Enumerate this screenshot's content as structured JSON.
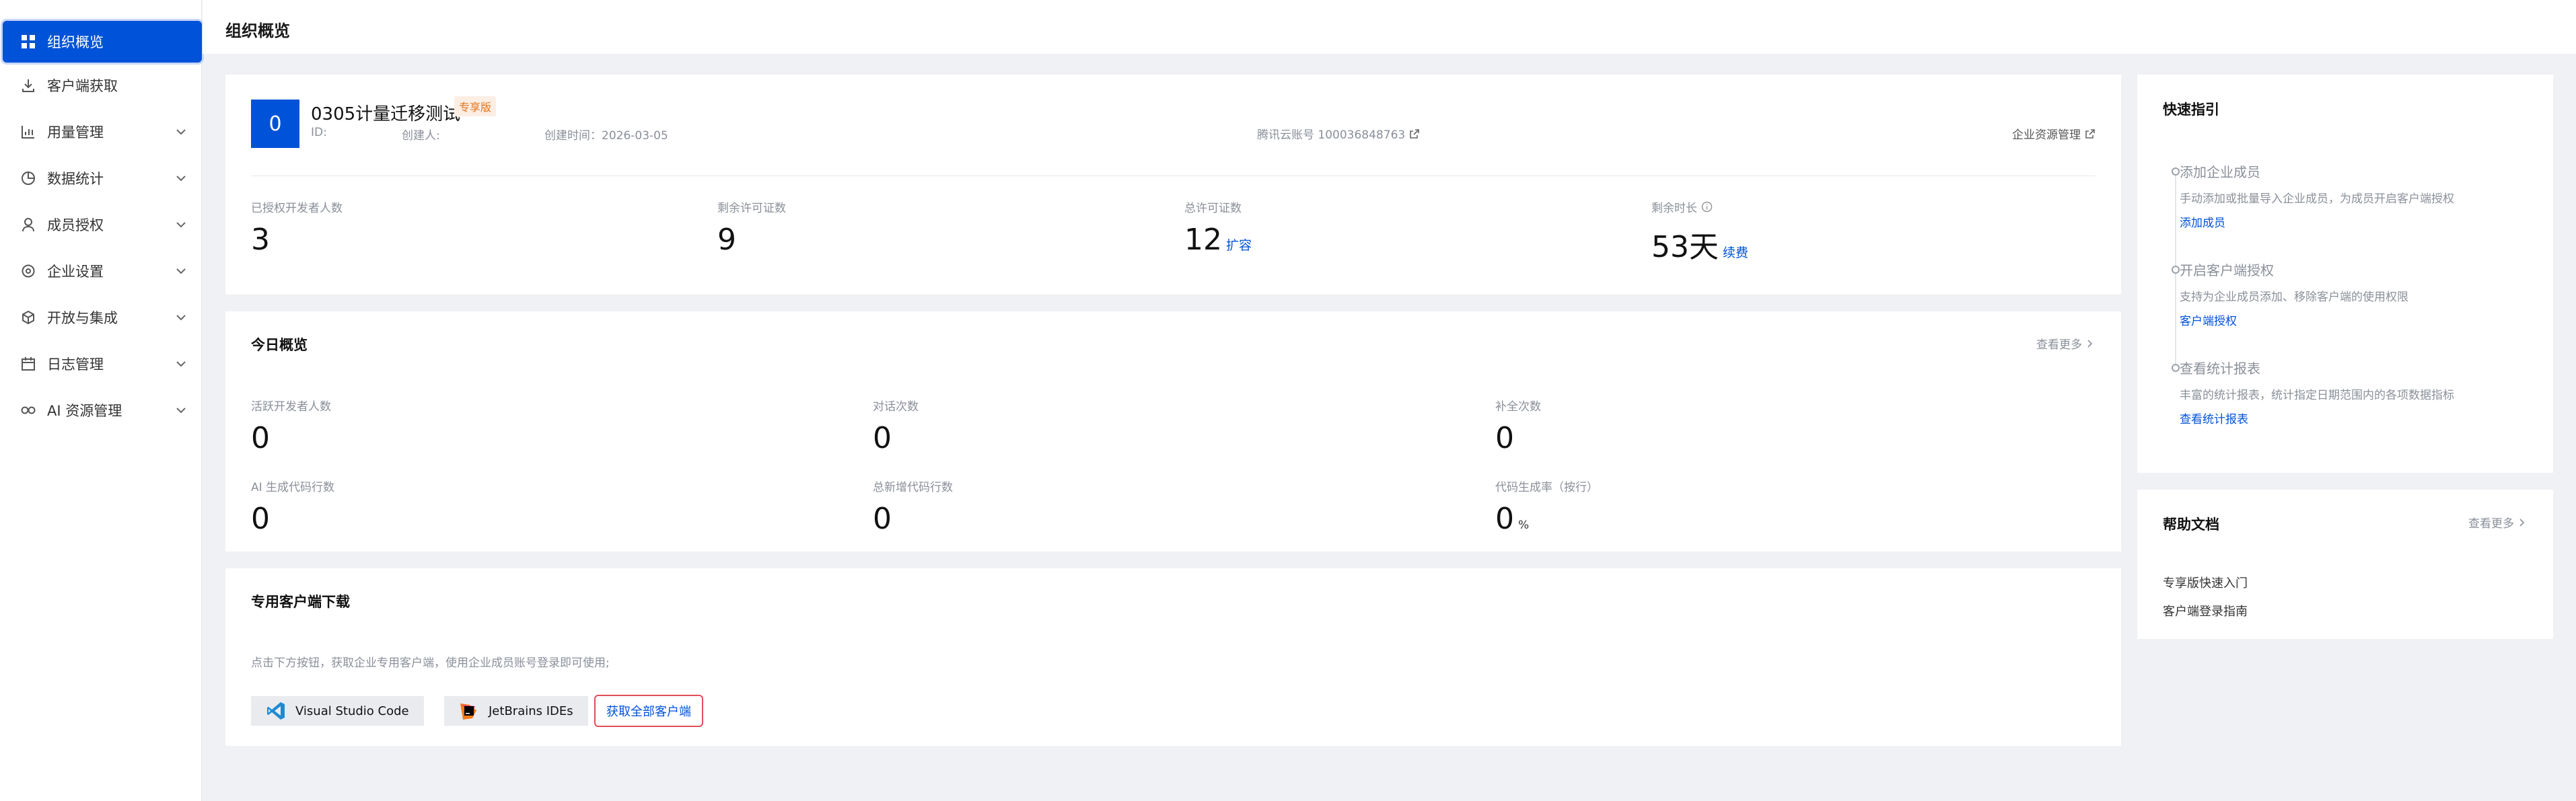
{
  "sidebar": {
    "items": [
      {
        "label": "组织概览",
        "icon": "dashboard-icon"
      },
      {
        "label": "客户端获取",
        "icon": "download-icon"
      },
      {
        "label": "用量管理",
        "icon": "bar-chart-icon"
      },
      {
        "label": "数据统计",
        "icon": "pie-chart-icon"
      },
      {
        "label": "成员授权",
        "icon": "user-icon"
      },
      {
        "label": "企业设置",
        "icon": "gear-icon"
      },
      {
        "label": "开放与集成",
        "icon": "cube-icon"
      },
      {
        "label": "日志管理",
        "icon": "calendar-icon"
      },
      {
        "label": "AI 资源管理",
        "icon": "infinity-icon"
      }
    ]
  },
  "header": {
    "title": "组织概览"
  },
  "org": {
    "avatar": "0",
    "name": "0305计量迁移测试",
    "badge": "专享版",
    "id_label": "ID:",
    "creator_label": "创建人:",
    "created_time": "创建时间：2026-03-05",
    "cloud_account": "腾讯云账号 100036848763",
    "resource_link": "企业资源管理",
    "stats": [
      {
        "label": "已授权开发者人数",
        "value": "3",
        "action": ""
      },
      {
        "label": "剩余许可证数",
        "value": "9",
        "action": ""
      },
      {
        "label": "总许可证数",
        "value": "12",
        "action": "扩容"
      },
      {
        "label": "剩余时长",
        "value": "53天",
        "action": "续费"
      }
    ]
  },
  "today": {
    "title": "今日概览",
    "more": "查看更多",
    "stats": [
      {
        "label": "活跃开发者人数",
        "value": "0",
        "unit": ""
      },
      {
        "label": "对话次数",
        "value": "0",
        "unit": ""
      },
      {
        "label": "补全次数",
        "value": "0",
        "unit": ""
      },
      {
        "label": "AI 生成代码行数",
        "value": "0",
        "unit": ""
      },
      {
        "label": "总新增代码行数",
        "value": "0",
        "unit": ""
      },
      {
        "label": "代码生成率（按行）",
        "value": "0",
        "unit": "%"
      }
    ]
  },
  "download": {
    "title": "专用客户端下载",
    "desc": "点击下方按钮，获取企业专用客户端，使用企业成员账号登录即可使用;",
    "vscode": "Visual Studio Code",
    "jetbrains": "JetBrains IDEs",
    "all": "获取全部客户端"
  },
  "guide": {
    "title": "快速指引",
    "steps": [
      {
        "title": "添加企业成员",
        "desc": "手动添加或批量导入企业成员，为成员开启客户端授权",
        "link": "添加成员"
      },
      {
        "title": "开启客户端授权",
        "desc": "支持为企业成员添加、移除客户端的使用权限",
        "link": "客户端授权"
      },
      {
        "title": "查看统计报表",
        "desc": "丰富的统计报表，统计指定日期范围内的各项数据指标",
        "link": "查看统计报表"
      }
    ]
  },
  "help": {
    "title": "帮助文档",
    "more": "查看更多",
    "links": [
      "专享版快速入门",
      "客户端登录指南"
    ]
  },
  "colors": {
    "accent": "#0052d9",
    "badge_text": "#e37318",
    "badge_bg": "#fdeee4",
    "highlight_border": "#e34d59"
  }
}
